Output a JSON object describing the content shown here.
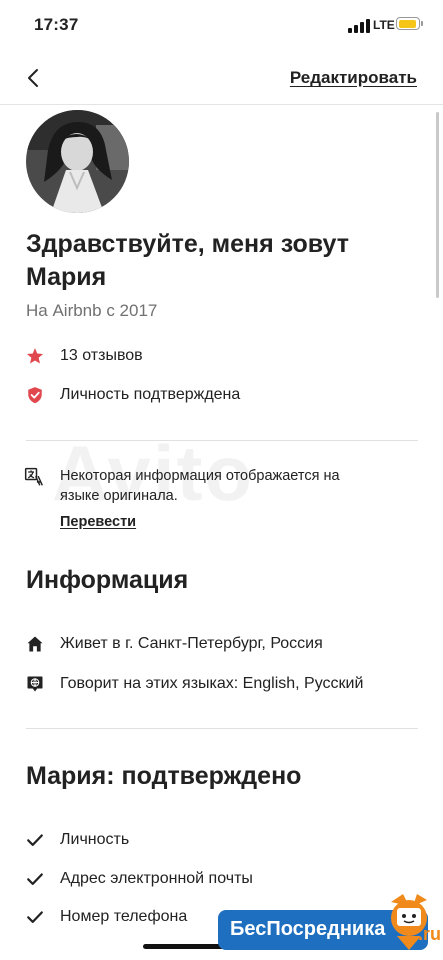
{
  "status_bar": {
    "time": "17:37",
    "network": "LTE",
    "battery_color": "#f5c518"
  },
  "nav": {
    "back_icon": "chevron-left-icon",
    "edit_label": "Редактировать"
  },
  "profile": {
    "greeting": "Здравствуйте, меня зовут Мария",
    "member_since": "На Airbnb с 2017",
    "reviews": "13 отзывов",
    "identity_verified": "Личность подтверждена",
    "accent_color": "#e0484e"
  },
  "translation": {
    "note": "Некоторая информация отображается на языке оригинала.",
    "link_label": "Перевести"
  },
  "info": {
    "title": "Информация",
    "lives_in": "Живет в г. Санкт-Петербург, Россия",
    "languages": "Говорит на этих языках: English, Русский"
  },
  "confirmed": {
    "title": "Мария: подтверждено",
    "items": [
      "Личность",
      "Адрес электронной почты",
      "Номер телефона"
    ]
  },
  "overlays": {
    "watermark": "Avito",
    "ad_badge": "БесПосредника",
    "ad_domain": ".ru"
  }
}
